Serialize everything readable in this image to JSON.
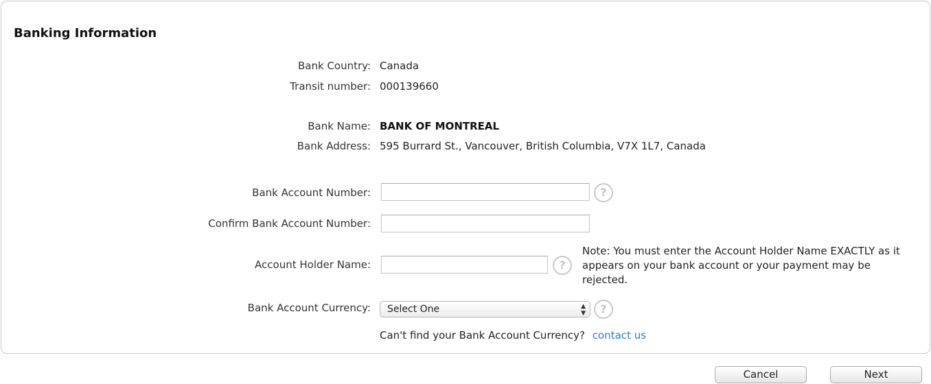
{
  "section": {
    "title": "Banking Information"
  },
  "bank": {
    "country_label": "Bank Country:",
    "country_value": "Canada",
    "transit_label": "Transit number:",
    "transit_value": "000139660",
    "name_label": "Bank Name:",
    "name_value": "BANK OF MONTREAL",
    "address_label": "Bank Address:",
    "address_value": "595 Burrard St., Vancouver, British Columbia, V7X 1L7, Canada"
  },
  "form": {
    "account_number_label": "Bank Account Number:",
    "account_number_value": "",
    "confirm_account_label": "Confirm Bank Account Number:",
    "confirm_account_value": "",
    "holder_name_label": "Account Holder Name:",
    "holder_name_value": "",
    "holder_note": "Note: You must enter the Account Holder Name EXACTLY as it appears on your bank account or your payment may be rejected.",
    "currency_label": "Bank Account Currency:",
    "currency_selected": "Select One",
    "currency_help_text": "Can't find your Bank Account Currency?",
    "contact_link": "contact us",
    "help_glyph": "?"
  },
  "buttons": {
    "cancel": "Cancel",
    "next": "Next"
  },
  "icons": {
    "help": "question-circle-icon",
    "select_arrows": "up-down-chevron-icon"
  },
  "colors": {
    "link": "#1f7fd0",
    "panel_border": "#c9c9c9"
  }
}
